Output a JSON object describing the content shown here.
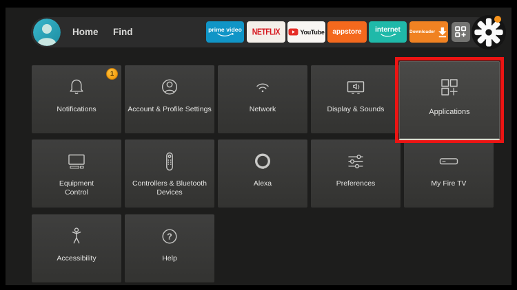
{
  "topbar": {
    "home_label": "Home",
    "find_label": "Find",
    "apps": [
      {
        "label": "prime video",
        "bg": "#1095c7"
      },
      {
        "label": "NETFLIX",
        "bg": "#f4efe9",
        "fg": "#d6181f"
      },
      {
        "label": "YouTube",
        "bg": "#f8f6f3"
      },
      {
        "label": "appstore",
        "bg": "#f4691d"
      },
      {
        "label": "internet",
        "bg": "#1fb9a9"
      },
      {
        "label": "Downloader",
        "bg": "#f08222"
      }
    ],
    "settings_gear_has_notification_dot": true
  },
  "tiles": [
    {
      "label": "Notifications",
      "badge": "1"
    },
    {
      "label": "Account & Profile Settings"
    },
    {
      "label": "Network"
    },
    {
      "label": "Display & Sounds"
    },
    {
      "label": "Applications",
      "highlighted": true
    },
    {
      "label": "Equipment Control"
    },
    {
      "label": "Controllers & Bluetooth Devices"
    },
    {
      "label": "Alexa"
    },
    {
      "label": "Preferences"
    },
    {
      "label": "My Fire TV"
    },
    {
      "label": "Accessibility"
    },
    {
      "label": "Help"
    }
  ],
  "colors": {
    "highlight_red": "#ec1413",
    "badge_orange": "#f09200",
    "gear_dot_orange": "#f7941d",
    "avatar_teal": "#2aa6ba",
    "background": "#1d1d1c",
    "tile_gray": "#3a3a39"
  }
}
